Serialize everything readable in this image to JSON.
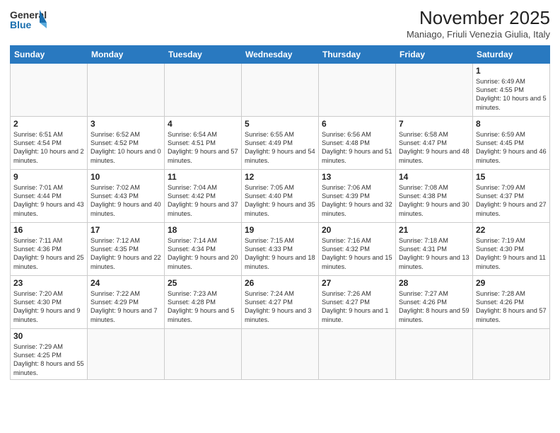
{
  "header": {
    "logo_general": "General",
    "logo_blue": "Blue",
    "month_title": "November 2025",
    "location": "Maniago, Friuli Venezia Giulia, Italy"
  },
  "weekdays": [
    "Sunday",
    "Monday",
    "Tuesday",
    "Wednesday",
    "Thursday",
    "Friday",
    "Saturday"
  ],
  "days": [
    {
      "date": "",
      "info": ""
    },
    {
      "date": "",
      "info": ""
    },
    {
      "date": "",
      "info": ""
    },
    {
      "date": "",
      "info": ""
    },
    {
      "date": "",
      "info": ""
    },
    {
      "date": "",
      "info": ""
    },
    {
      "date": "1",
      "info": "Sunrise: 6:49 AM\nSunset: 4:55 PM\nDaylight: 10 hours and 5 minutes."
    },
    {
      "date": "2",
      "info": "Sunrise: 6:51 AM\nSunset: 4:54 PM\nDaylight: 10 hours and 2 minutes."
    },
    {
      "date": "3",
      "info": "Sunrise: 6:52 AM\nSunset: 4:52 PM\nDaylight: 10 hours and 0 minutes."
    },
    {
      "date": "4",
      "info": "Sunrise: 6:54 AM\nSunset: 4:51 PM\nDaylight: 9 hours and 57 minutes."
    },
    {
      "date": "5",
      "info": "Sunrise: 6:55 AM\nSunset: 4:49 PM\nDaylight: 9 hours and 54 minutes."
    },
    {
      "date": "6",
      "info": "Sunrise: 6:56 AM\nSunset: 4:48 PM\nDaylight: 9 hours and 51 minutes."
    },
    {
      "date": "7",
      "info": "Sunrise: 6:58 AM\nSunset: 4:47 PM\nDaylight: 9 hours and 48 minutes."
    },
    {
      "date": "8",
      "info": "Sunrise: 6:59 AM\nSunset: 4:45 PM\nDaylight: 9 hours and 46 minutes."
    },
    {
      "date": "9",
      "info": "Sunrise: 7:01 AM\nSunset: 4:44 PM\nDaylight: 9 hours and 43 minutes."
    },
    {
      "date": "10",
      "info": "Sunrise: 7:02 AM\nSunset: 4:43 PM\nDaylight: 9 hours and 40 minutes."
    },
    {
      "date": "11",
      "info": "Sunrise: 7:04 AM\nSunset: 4:42 PM\nDaylight: 9 hours and 37 minutes."
    },
    {
      "date": "12",
      "info": "Sunrise: 7:05 AM\nSunset: 4:40 PM\nDaylight: 9 hours and 35 minutes."
    },
    {
      "date": "13",
      "info": "Sunrise: 7:06 AM\nSunset: 4:39 PM\nDaylight: 9 hours and 32 minutes."
    },
    {
      "date": "14",
      "info": "Sunrise: 7:08 AM\nSunset: 4:38 PM\nDaylight: 9 hours and 30 minutes."
    },
    {
      "date": "15",
      "info": "Sunrise: 7:09 AM\nSunset: 4:37 PM\nDaylight: 9 hours and 27 minutes."
    },
    {
      "date": "16",
      "info": "Sunrise: 7:11 AM\nSunset: 4:36 PM\nDaylight: 9 hours and 25 minutes."
    },
    {
      "date": "17",
      "info": "Sunrise: 7:12 AM\nSunset: 4:35 PM\nDaylight: 9 hours and 22 minutes."
    },
    {
      "date": "18",
      "info": "Sunrise: 7:14 AM\nSunset: 4:34 PM\nDaylight: 9 hours and 20 minutes."
    },
    {
      "date": "19",
      "info": "Sunrise: 7:15 AM\nSunset: 4:33 PM\nDaylight: 9 hours and 18 minutes."
    },
    {
      "date": "20",
      "info": "Sunrise: 7:16 AM\nSunset: 4:32 PM\nDaylight: 9 hours and 15 minutes."
    },
    {
      "date": "21",
      "info": "Sunrise: 7:18 AM\nSunset: 4:31 PM\nDaylight: 9 hours and 13 minutes."
    },
    {
      "date": "22",
      "info": "Sunrise: 7:19 AM\nSunset: 4:30 PM\nDaylight: 9 hours and 11 minutes."
    },
    {
      "date": "23",
      "info": "Sunrise: 7:20 AM\nSunset: 4:30 PM\nDaylight: 9 hours and 9 minutes."
    },
    {
      "date": "24",
      "info": "Sunrise: 7:22 AM\nSunset: 4:29 PM\nDaylight: 9 hours and 7 minutes."
    },
    {
      "date": "25",
      "info": "Sunrise: 7:23 AM\nSunset: 4:28 PM\nDaylight: 9 hours and 5 minutes."
    },
    {
      "date": "26",
      "info": "Sunrise: 7:24 AM\nSunset: 4:27 PM\nDaylight: 9 hours and 3 minutes."
    },
    {
      "date": "27",
      "info": "Sunrise: 7:26 AM\nSunset: 4:27 PM\nDaylight: 9 hours and 1 minute."
    },
    {
      "date": "28",
      "info": "Sunrise: 7:27 AM\nSunset: 4:26 PM\nDaylight: 8 hours and 59 minutes."
    },
    {
      "date": "29",
      "info": "Sunrise: 7:28 AM\nSunset: 4:26 PM\nDaylight: 8 hours and 57 minutes."
    },
    {
      "date": "30",
      "info": "Sunrise: 7:29 AM\nSunset: 4:25 PM\nDaylight: 8 hours and 55 minutes."
    },
    {
      "date": "",
      "info": ""
    },
    {
      "date": "",
      "info": ""
    },
    {
      "date": "",
      "info": ""
    },
    {
      "date": "",
      "info": ""
    },
    {
      "date": "",
      "info": ""
    },
    {
      "date": "",
      "info": ""
    }
  ]
}
